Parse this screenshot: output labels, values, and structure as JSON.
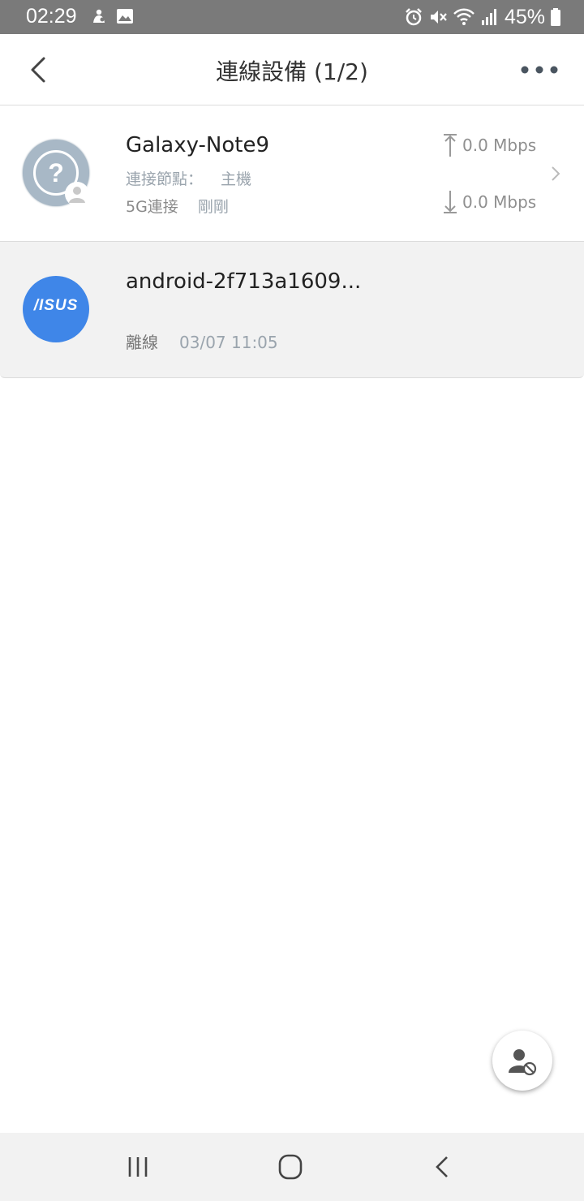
{
  "status_bar": {
    "time": "02:29",
    "battery": "45%",
    "left_icons": [
      "notification-icon",
      "image-icon"
    ],
    "right_icons": [
      "alarm-icon",
      "mute-icon",
      "wifi-icon",
      "signal-icon",
      "battery-icon"
    ]
  },
  "header": {
    "title": "連線設備 (1/2)",
    "back_icon": "back-arrow-icon",
    "more_icon": "more-options-icon"
  },
  "devices": [
    {
      "name": "Galaxy-Note9",
      "icon": "unknown-device-icon",
      "node_label": "連接節點：",
      "node_value": "主機",
      "connection": "5G連接",
      "last_seen": "剛剛",
      "upload": "0.0 Mbps",
      "download": "0.0 Mbps"
    },
    {
      "name": "android-2f713a1609...",
      "icon": "asus-logo",
      "logo_text": "/ISUS",
      "status": "離線",
      "last_seen": "03/07 11:05"
    }
  ],
  "fab": {
    "icon": "block-user-icon"
  },
  "nav_bar": {
    "items": [
      "recent-apps-icon",
      "home-icon",
      "back-icon"
    ]
  },
  "colors": {
    "status_bar": "#7a7a7a",
    "asus_blue": "#3f86e8",
    "unknown_avatar": "#a8b8c6",
    "muted_text": "#9aa4ad",
    "offline_row_bg": "#f2f2f2"
  }
}
